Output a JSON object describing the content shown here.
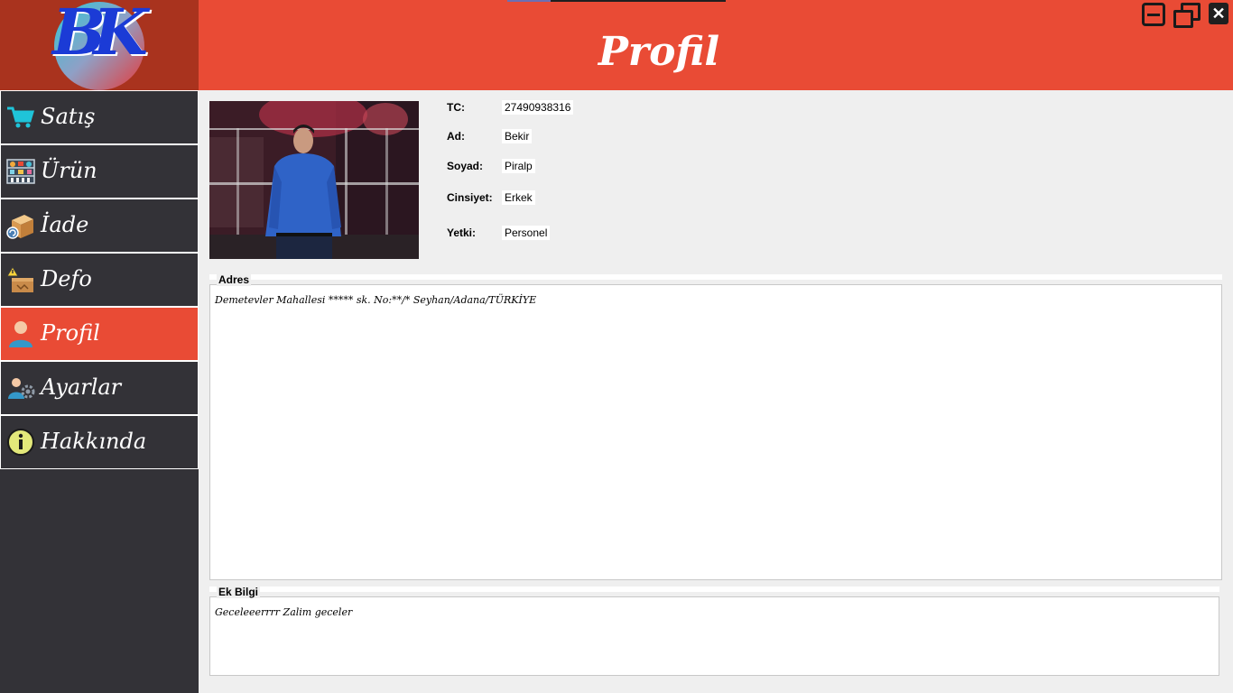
{
  "app": {
    "logo_text": "BK",
    "page_title": "Profil"
  },
  "window_controls": {
    "minimize_icon": "minimize-icon",
    "maximize_icon": "restore-icon",
    "close_icon": "close-icon",
    "close_label": "✕"
  },
  "sidebar": {
    "items": [
      {
        "label": "Satış",
        "icon": "cart-icon",
        "active": false
      },
      {
        "label": "Ürün",
        "icon": "products-icon",
        "active": false
      },
      {
        "label": "İade",
        "icon": "return-box-icon",
        "active": false
      },
      {
        "label": "Defo",
        "icon": "defect-box-icon",
        "active": false
      },
      {
        "label": "Profil",
        "icon": "user-icon",
        "active": true
      },
      {
        "label": "Ayarlar",
        "icon": "user-settings-icon",
        "active": false
      },
      {
        "label": "Hakkında",
        "icon": "info-icon",
        "active": false
      }
    ]
  },
  "profile": {
    "fields": [
      {
        "label": "TC:",
        "value": "27490938316"
      },
      {
        "label": "Ad:",
        "value": "Bekir"
      },
      {
        "label": "Soyad:",
        "value": "Piralp"
      },
      {
        "label": "Cinsiyet:",
        "value": "Erkek"
      },
      {
        "label": "Yetki:",
        "value": "Personel"
      }
    ],
    "address_title": "Adres",
    "address_text": "Demetevler Mahallesi ***** sk. No:**/* Seyhan/Adana/TÜRKİYE",
    "extra_title": "Ek Bilgi",
    "extra_text": "Geceleeerrrr Zalim geceler"
  },
  "colors": {
    "accent": "#e94b35",
    "sidebar_bg": "#333237",
    "logo_bg": "#a9331e",
    "content_bg": "#efefef"
  }
}
